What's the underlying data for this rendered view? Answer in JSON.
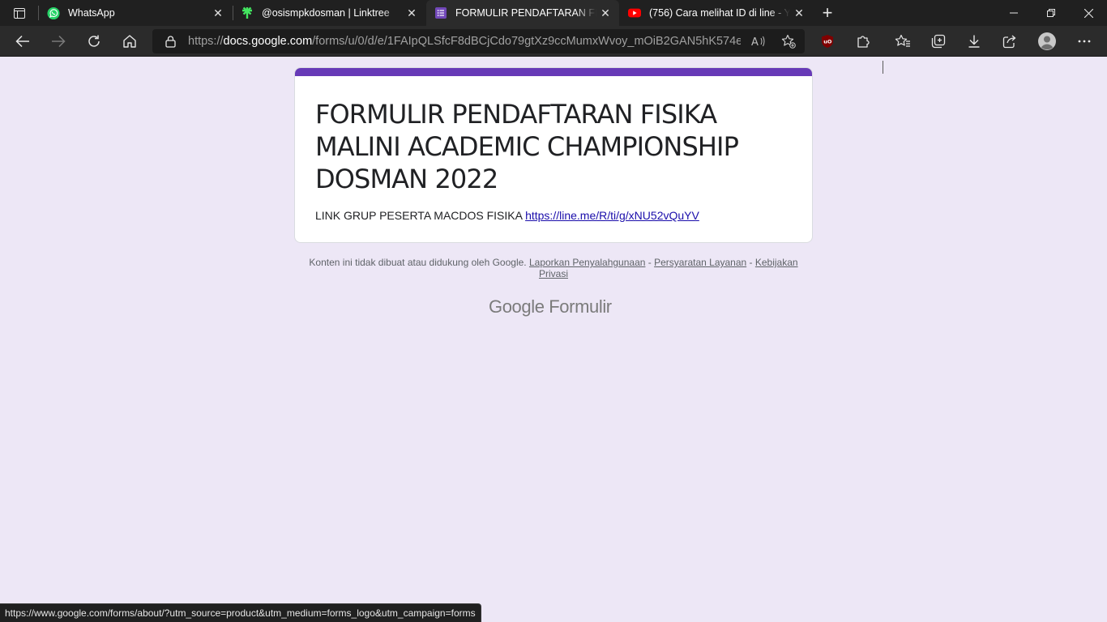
{
  "browser": {
    "tabs": [
      {
        "label": "WhatsApp",
        "icon": "whatsapp-icon"
      },
      {
        "label": "@osismpkdosman | Linktree",
        "icon": "linktree-icon"
      },
      {
        "label": "FORMULIR PENDAFTARAN FISIKA MALINI ACADEMIC CHAMPIONSHIP DOSMAN 2022",
        "icon": "google-forms-icon",
        "active": true
      },
      {
        "label": "(756) Cara melihat ID di line - YouTube",
        "icon": "youtube-icon"
      }
    ],
    "address": {
      "scheme": "https://",
      "host": "docs.google.com",
      "path": "/forms/u/0/d/e/1FAIpQLSfcF8dBCjCdo79gtXz9ccMumxWvoy_mOiB2GAN5hK574eEY..."
    },
    "accent_color": "#673ab7",
    "status_url": "https://www.google.com/forms/about/?utm_source=product&utm_medium=forms_logo&utm_campaign=forms"
  },
  "form": {
    "title": "FORMULIR PENDAFTARAN FISIKA MALINI ACADEMIC CHAMPIONSHIP DOSMAN 2022",
    "description_text": "LINK GRUP PESERTA MACDOS FISIKA ",
    "description_link": "https://line.me/R/ti/g/xNU52vQuYV"
  },
  "footer": {
    "disclaimer": "Konten ini tidak dibuat atau didukung oleh Google.",
    "report_link": "Laporkan Penyalahgunaan",
    "separator": " - ",
    "terms_link": "Persyaratan Layanan",
    "privacy_link": "Kebijakan Privasi",
    "logo_google": "Google",
    "logo_product": "Formulir"
  }
}
